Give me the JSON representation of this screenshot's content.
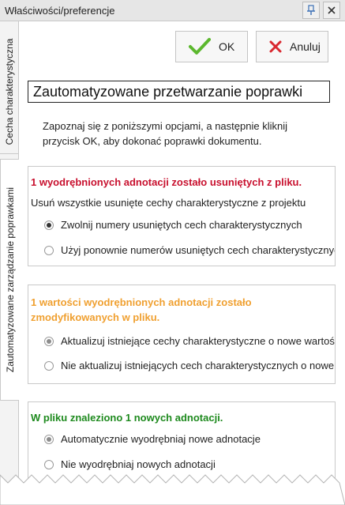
{
  "window": {
    "title": "Właściwości/preferencje"
  },
  "tabs": [
    {
      "label": "Cecha charakterystyczna"
    },
    {
      "label": "Zautomatyzowane zarządzanie poprawkami"
    }
  ],
  "toolbar": {
    "ok_label": "OK",
    "cancel_label": "Anuluj"
  },
  "main": {
    "heading": "Zautomatyzowane przetwarzanie poprawki",
    "intro": "Zapoznaj się z poniższymi opcjami, a następnie kliknij przycisk OK, aby dokonać poprawki dokumentu."
  },
  "groups": [
    {
      "title": "1 wyodrębnionych adnotacji zostało usuniętych z pliku.",
      "title_color": "#c8102e",
      "description": "Usuń wszystkie usunięte cechy charakterystyczne z projektu",
      "options": [
        {
          "label": "Zwolnij numery usuniętych cech charakterystycznych",
          "checked": true
        },
        {
          "label": "Użyj ponownie numerów usuniętych cech charakterystycznych",
          "checked": false
        }
      ]
    },
    {
      "title": "1 wartości wyodrębnionych adnotacji zostało zmodyfikowanych w pliku.",
      "title_color": "#f0a030",
      "options": [
        {
          "label": "Aktualizuj istniejące cechy charakterystyczne o nowe wartości",
          "checked": true
        },
        {
          "label": "Nie aktualizuj istniejących cech charakterystycznych o nowe wartości",
          "checked": false
        }
      ]
    },
    {
      "title": "W pliku znaleziono 1 nowych adnotacji.",
      "title_color": "#1e8a1e",
      "options": [
        {
          "label": "Automatycznie wyodrębniaj nowe adnotacje",
          "checked": true
        },
        {
          "label": "Nie wyodrębniaj nowych adnotacji",
          "checked": false
        }
      ]
    }
  ],
  "colors": {
    "ok_check": "#5cb82e",
    "cancel_x": "#d9282f"
  },
  "icons": [
    "pin-icon",
    "close-icon",
    "checkmark-icon",
    "cancel-x-icon"
  ]
}
